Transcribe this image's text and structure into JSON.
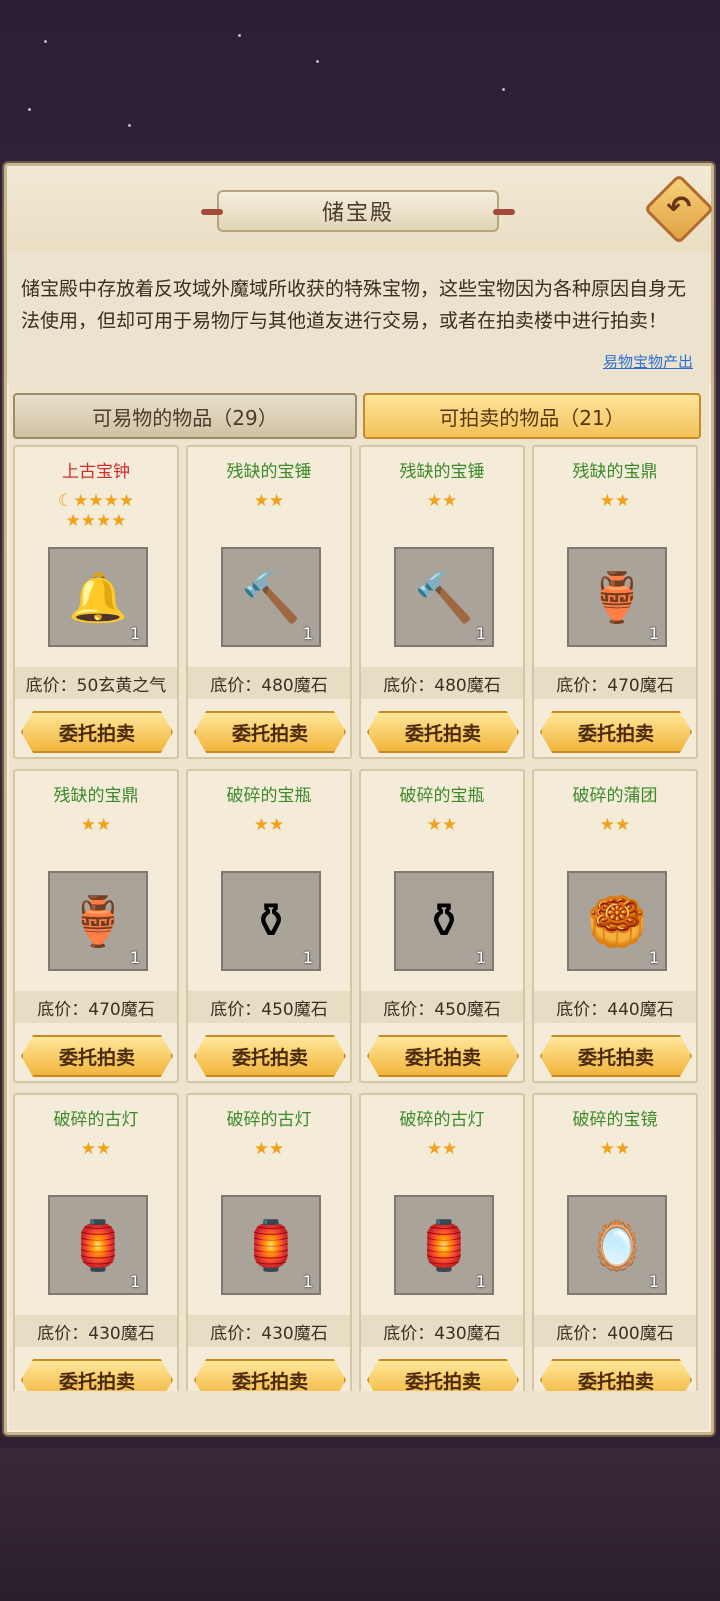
{
  "title": "储宝殿",
  "description": "储宝殿中存放着反攻域外魔域所收获的特殊宝物，这些宝物因为各种原因自身无法使用，但却可用于易物厅与其他道友进行交易，或者在拍卖楼中进行拍卖！",
  "link_label": "易物宝物产出",
  "tabs": [
    {
      "label": "可易物的物品（29）",
      "active": false
    },
    {
      "label": "可拍卖的物品（21）",
      "active": true
    }
  ],
  "items": [
    {
      "name": "上古宝钟",
      "stars": "☾★★★★★★★★",
      "price": "底价：50玄黄之气",
      "qty": "1",
      "icon": "golden-bell-icon",
      "rare": true
    },
    {
      "name": "残缺的宝锤",
      "stars": "★★",
      "price": "底价：480魔石",
      "qty": "1",
      "icon": "hammer-icon"
    },
    {
      "name": "残缺的宝锤",
      "stars": "★★",
      "price": "底价：480魔石",
      "qty": "1",
      "icon": "hammer-icon"
    },
    {
      "name": "残缺的宝鼎",
      "stars": "★★",
      "price": "底价：470魔石",
      "qty": "1",
      "icon": "cauldron-icon"
    },
    {
      "name": "残缺的宝鼎",
      "stars": "★★",
      "price": "底价：470魔石",
      "qty": "1",
      "icon": "cauldron-icon"
    },
    {
      "name": "破碎的宝瓶",
      "stars": "★★",
      "price": "底价：450魔石",
      "qty": "1",
      "icon": "vase-icon"
    },
    {
      "name": "破碎的宝瓶",
      "stars": "★★",
      "price": "底价：450魔石",
      "qty": "1",
      "icon": "vase-icon"
    },
    {
      "name": "破碎的蒲团",
      "stars": "★★",
      "price": "底价：440魔石",
      "qty": "1",
      "icon": "cushion-icon"
    },
    {
      "name": "破碎的古灯",
      "stars": "★★",
      "price": "底价：430魔石",
      "qty": "1",
      "icon": "lantern-icon"
    },
    {
      "name": "破碎的古灯",
      "stars": "★★",
      "price": "底价：430魔石",
      "qty": "1",
      "icon": "lantern-icon"
    },
    {
      "name": "破碎的古灯",
      "stars": "★★",
      "price": "底价：430魔石",
      "qty": "1",
      "icon": "lantern-icon"
    },
    {
      "name": "破碎的宝镜",
      "stars": "★★",
      "price": "底价：400魔石",
      "qty": "1",
      "icon": "mirror-icon"
    }
  ],
  "button_label": "委托拍卖",
  "back_icon": "back-arrow-icon"
}
